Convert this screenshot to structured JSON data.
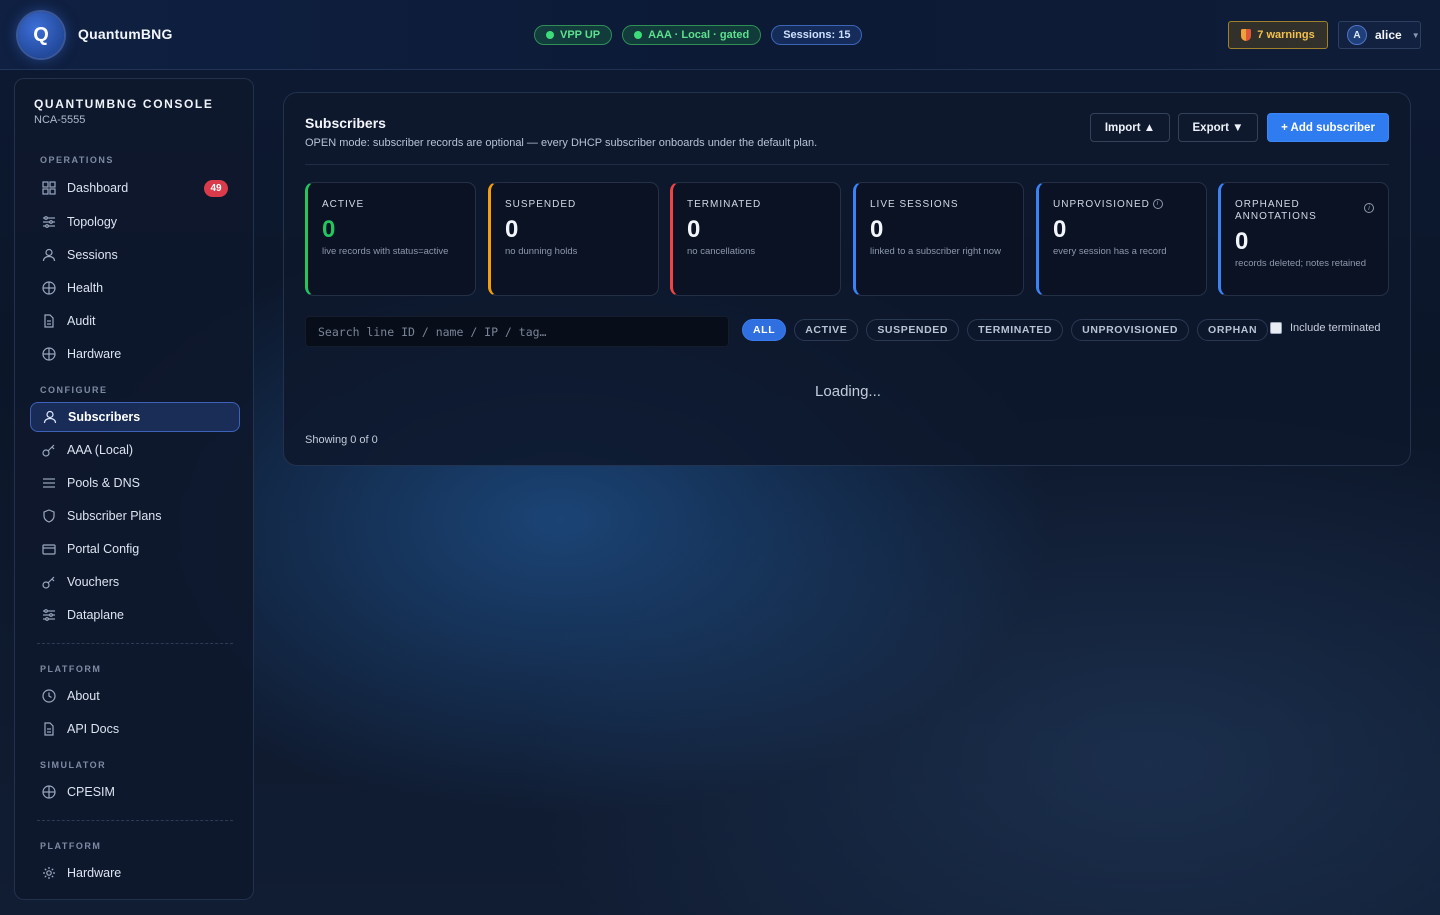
{
  "app": {
    "logo_letter": "Q",
    "name": "QuantumBNG"
  },
  "status": [
    {
      "label": "VPP UP",
      "variant": "green",
      "dot": true
    },
    {
      "label": "AAA · Local · gated",
      "variant": "green",
      "dot": true
    },
    {
      "label": "Sessions: 15",
      "variant": "blue",
      "dot": false
    }
  ],
  "header": {
    "warnings_label": "7 warnings",
    "user_initial": "A",
    "user_name": "alice"
  },
  "sidebar": {
    "title": "QUANTUMBNG CONSOLE",
    "subtitle": "NCA-5555",
    "sections": {
      "operations": "OPERATIONS",
      "configure": "CONFIGURE",
      "platform": "PLATFORM",
      "simulator": "SIMULATOR",
      "platform2": "PLATFORM"
    },
    "items": [
      {
        "label": "Dashboard",
        "icon": "grid-icon",
        "badge": "49"
      },
      {
        "label": "Topology",
        "icon": "sliders-icon"
      },
      {
        "label": "Sessions",
        "icon": "user-icon"
      },
      {
        "label": "Health",
        "icon": "globe-icon"
      },
      {
        "label": "Audit",
        "icon": "document-icon"
      },
      {
        "label": "Hardware",
        "icon": "globe-icon"
      },
      {
        "label": "Subscribers",
        "icon": "user-icon",
        "active": true
      },
      {
        "label": "AAA (Local)",
        "icon": "key-icon"
      },
      {
        "label": "Pools & DNS",
        "icon": "list-icon"
      },
      {
        "label": "Subscriber Plans",
        "icon": "shield-icon"
      },
      {
        "label": "Portal Config",
        "icon": "card-icon"
      },
      {
        "label": "Vouchers",
        "icon": "key-icon"
      },
      {
        "label": "Dataplane",
        "icon": "sliders-icon"
      },
      {
        "label": "About",
        "icon": "clock-icon"
      },
      {
        "label": "API Docs",
        "icon": "document-icon"
      },
      {
        "label": "CPESIM",
        "icon": "globe-icon"
      },
      {
        "label": "Hardware",
        "icon": "gear-icon"
      }
    ]
  },
  "main": {
    "title": "Subscribers",
    "subtitle": "OPEN mode: subscriber records are optional — every DHCP subscriber onboards under the default plan.",
    "import_label": "Import ▲",
    "export_label": "Export ▼",
    "add_label": "+ Add subscriber",
    "cards": [
      {
        "label": "ACTIVE",
        "value": "0",
        "desc": "live records with status=active",
        "accent": "#22c55e",
        "value_color": "#22c55e"
      },
      {
        "label": "SUSPENDED",
        "value": "0",
        "desc": "no dunning holds",
        "accent": "#f59e0b"
      },
      {
        "label": "TERMINATED",
        "value": "0",
        "desc": "no cancellations",
        "accent": "#ef4444"
      },
      {
        "label": "LIVE SESSIONS",
        "value": "0",
        "desc": "linked to a subscriber right now",
        "accent": "#3b82f6"
      },
      {
        "label": "UNPROVISIONED",
        "value": "0",
        "desc": "every session has a record",
        "accent": "#3b82f6",
        "info": true
      },
      {
        "label": "ORPHANED ANNOTATIONS",
        "value": "0",
        "desc": "records deleted; notes retained",
        "accent": "#3b82f6",
        "info": true
      }
    ],
    "search_placeholder": "Search line ID / name / IP / tag…",
    "filters": [
      "ALL",
      "ACTIVE",
      "SUSPENDED",
      "TERMINATED",
      "UNPROVISIONED",
      "ORPHAN"
    ],
    "active_filter": "ALL",
    "include_terminated_label": "Include terminated",
    "include_terminated": false,
    "loading_text": "Loading...",
    "showing_text": "Showing 0 of 0"
  }
}
